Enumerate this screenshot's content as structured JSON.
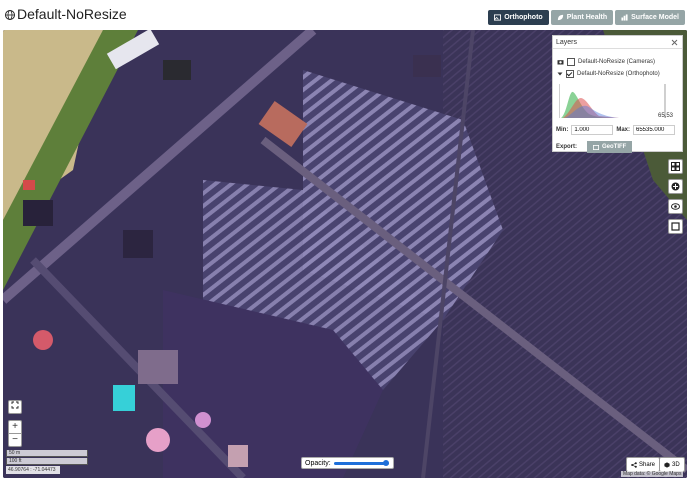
{
  "header": {
    "title": "Default-NoResize",
    "tabs": [
      {
        "label": "Orthophoto",
        "icon": "image-icon",
        "active": true
      },
      {
        "label": "Plant Health",
        "icon": "leaf-icon",
        "active": false
      },
      {
        "label": "Surface Model",
        "icon": "chart-icon",
        "active": false
      }
    ]
  },
  "layers": {
    "title": "Layers",
    "items": [
      {
        "label": "Default-NoResize (Cameras)",
        "checked": false,
        "icon": "camera-icon"
      },
      {
        "label": "Default-NoResize (Orthophoto)",
        "checked": true,
        "icon": "caret-down-icon"
      }
    ],
    "hist_max_label": "65,53",
    "min_label": "Min:",
    "min_value": "1.000",
    "max_label": "Max:",
    "max_value": "65535.000",
    "export_label": "Export:",
    "geotiff_label": "GeoTIFF"
  },
  "map": {
    "scale_m": "50 m",
    "scale_ft": "100 ft",
    "coords": "46.90764 : -71.04473",
    "opacity_label": "Opacity:",
    "opacity_value": 0.95,
    "share_label": "Share",
    "btn3d_label": "3D",
    "attribution": "Map data: © Google Maps"
  },
  "colors": {
    "active_tab": "#2c3e50",
    "inactive_tab": "#95a5a6",
    "slider": "#1e6fd9"
  }
}
